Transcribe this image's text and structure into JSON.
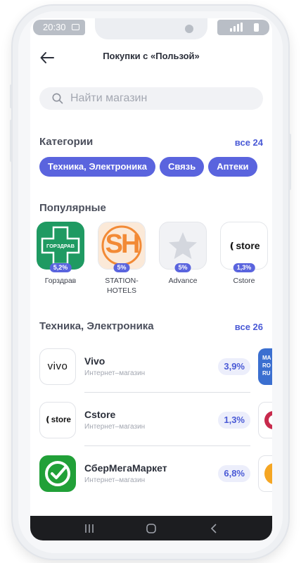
{
  "status_bar": {
    "time": "20:30"
  },
  "header": {
    "title": "Покупки с «Пользой»"
  },
  "search": {
    "placeholder": "Найти магазин"
  },
  "categories": {
    "title": "Категории",
    "all_label": "все 24",
    "chips": [
      "Техника, Электроника",
      "Связь",
      "Аптеки"
    ]
  },
  "popular": {
    "title": "Популярные",
    "items": [
      {
        "name": "Горздрав",
        "cashback": "5,2%",
        "logo_text": "ГОРЗДРАВ"
      },
      {
        "name": "STATION-HOTELS",
        "cashback": "5%",
        "logo_text": "SH"
      },
      {
        "name": "Advance",
        "cashback": "5%",
        "logo_text": ""
      },
      {
        "name": "Cstore",
        "cashback": "1,3%",
        "logo_text": "store"
      }
    ]
  },
  "electronics": {
    "title": "Техника, Электроника",
    "all_label": "все 26",
    "stores": [
      {
        "name": "Vivo",
        "type": "Интернет–магазин",
        "cashback": "3,9%",
        "logo_text": "vivo"
      },
      {
        "name": "Cstore",
        "type": "Интернет–магазин",
        "cashback": "1,3%",
        "logo_text": "store"
      },
      {
        "name": "СберМегаМаркет",
        "type": "Интернет–магазин",
        "cashback": "6,8%",
        "logo_text": ""
      }
    ],
    "peek_logo_text": "MA\nRO\nRU"
  },
  "colors": {
    "accent": "#5a64de",
    "accent_text": "#4a5ad6",
    "gorzdrav_green": "#1f9a62",
    "sh_orange": "#f28a36",
    "sber_green": "#21a038"
  },
  "icons": [
    "back-arrow-icon",
    "search-icon",
    "star-icon",
    "nav-recents-icon",
    "nav-home-icon",
    "nav-back-icon"
  ]
}
